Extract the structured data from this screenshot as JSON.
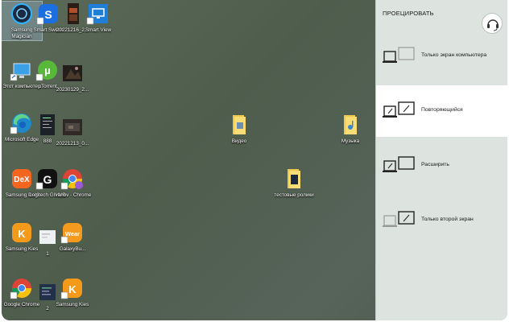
{
  "desktop": {
    "icons": [
      {
        "label": "Samsung Magician"
      },
      {
        "label": "Smart Switch"
      },
      {
        "label": "20221216_2..."
      },
      {
        "label": "Smart View"
      },
      {
        "label": "Этот компьютер"
      },
      {
        "label": "µTorrent"
      },
      {
        "label": "20230129_2..."
      },
      {
        "label": "Microsoft Edge"
      },
      {
        "label": "888"
      },
      {
        "label": "20221213_0..."
      },
      {
        "label": "Samsung DeX"
      },
      {
        "label": "Logitech G HUB"
      },
      {
        "label": "Ivanov - Chrome"
      },
      {
        "label": "Samsung Kies"
      },
      {
        "label": "1"
      },
      {
        "label": "GalaxyBu..."
      },
      {
        "label": "Google Chrome"
      },
      {
        "label": "2"
      },
      {
        "label": "Samsung Kies"
      },
      {
        "label": "Видео"
      },
      {
        "label": "Музыка"
      },
      {
        "label": "тестовые ролики"
      }
    ]
  },
  "project_panel": {
    "title": "ПРОЕЦИРОВАТЬ",
    "options": [
      {
        "label": "Только экран компьютера"
      },
      {
        "label": "Повторяющийся"
      },
      {
        "label": "Расширить"
      },
      {
        "label": "Только второй экран"
      }
    ],
    "selected": "Повторяющийся"
  }
}
